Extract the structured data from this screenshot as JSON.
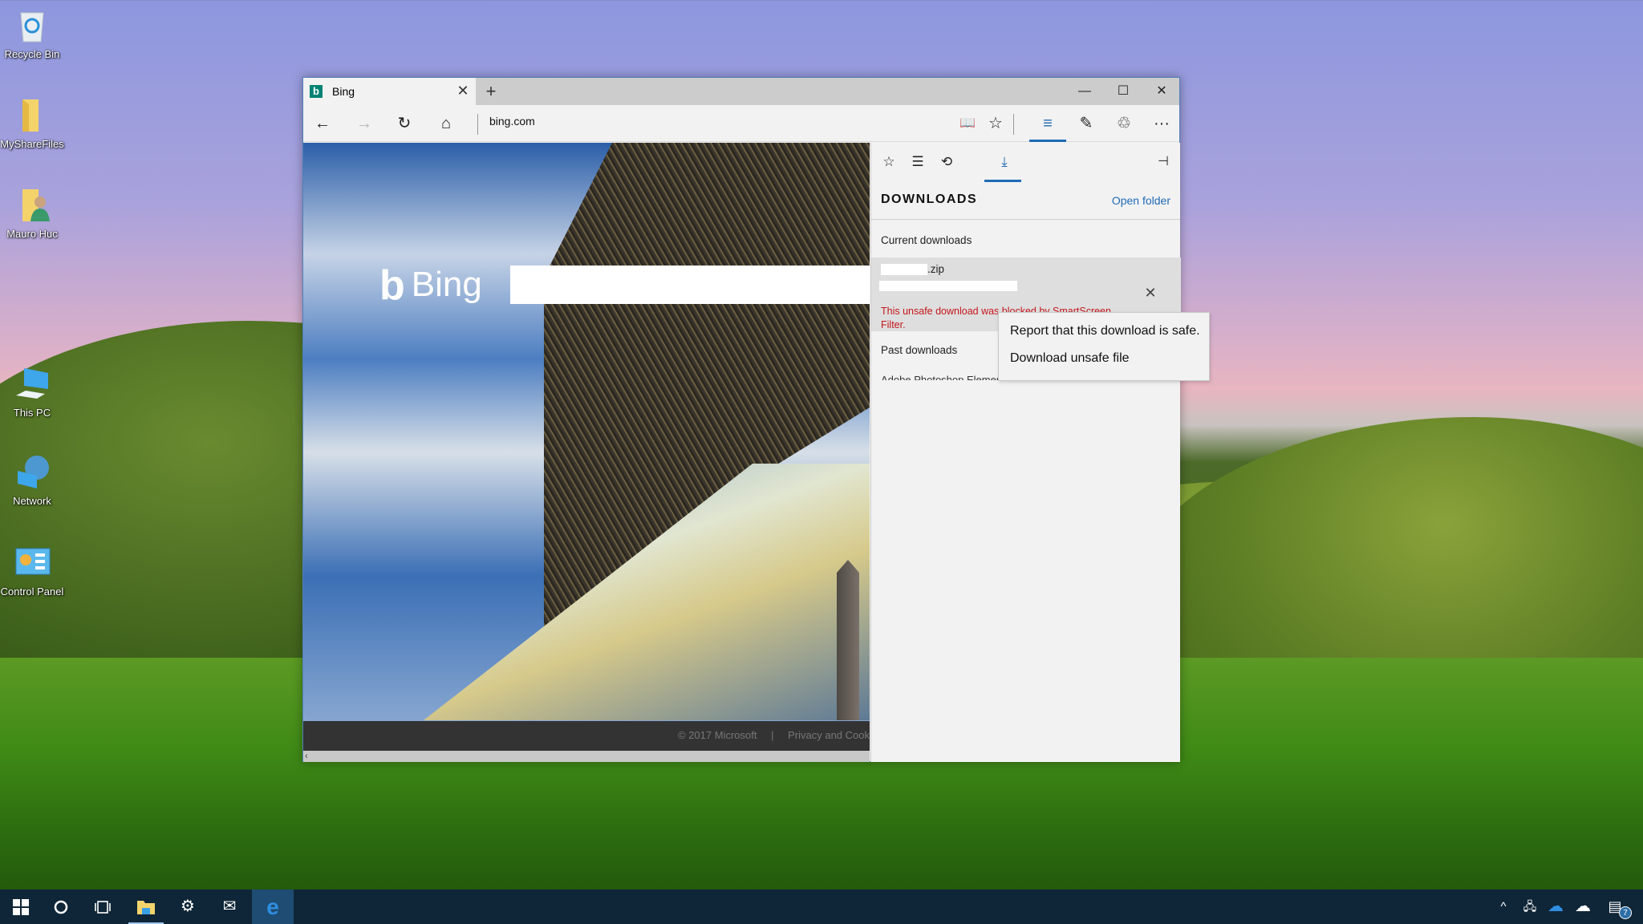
{
  "desktop": {
    "icons": [
      {
        "label": "Recycle Bin",
        "icon": "recycle-bin-icon"
      },
      {
        "label": "MyShareFiles",
        "icon": "folder-icon"
      },
      {
        "label": "Mauro Huc",
        "icon": "user-folder-icon"
      },
      {
        "label": "This PC",
        "icon": "computer-icon"
      },
      {
        "label": "Network",
        "icon": "network-icon"
      },
      {
        "label": "Control Panel",
        "icon": "control-panel-icon"
      }
    ]
  },
  "browser": {
    "tab": {
      "title": "Bing",
      "favicon": "b",
      "close": "✕"
    },
    "new_tab": "+",
    "window_controls": {
      "minimize": "—",
      "maximize": "☐",
      "close": "✕"
    },
    "toolbar": {
      "back": "←",
      "forward": "→",
      "refresh": "↻",
      "home": "⌂",
      "address": "bing.com",
      "reading_view": "📖",
      "favorite": "☆",
      "hub": "≡",
      "web_note": "✎",
      "share": "♲",
      "more": "···"
    },
    "page": {
      "logo_mark": "b",
      "logo_text": "Bing",
      "search_placeholder": "",
      "footer_copyright": "© 2017 Microsoft",
      "footer_sep": "|",
      "footer_link": "Privacy and Cook",
      "scroll_left": "‹"
    },
    "hub": {
      "tabs": [
        {
          "name": "favorites",
          "glyph": "☆"
        },
        {
          "name": "reading-list",
          "glyph": "☰"
        },
        {
          "name": "history",
          "glyph": "⟲"
        },
        {
          "name": "downloads",
          "glyph": "⤓",
          "active": true
        }
      ],
      "pin": "⊣",
      "title": "DOWNLOADS",
      "open_folder": "Open folder",
      "current_label": "Current downloads",
      "current_item": {
        "file_name": ".zip",
        "close": "✕",
        "warning": "This unsafe download was blocked by SmartScreen Filter."
      },
      "past_label": "Past downloads",
      "past_items": [
        "Adobe Photoshop Elements ... ... ..."
      ]
    },
    "context_menu": {
      "items": [
        "Report that this download is safe.",
        "Download unsafe file"
      ]
    }
  },
  "taskbar": {
    "start": "⊞",
    "cortana": "○",
    "task_view": "❐",
    "apps": [
      {
        "name": "file-explorer",
        "glyph": "📁",
        "running": true
      },
      {
        "name": "settings",
        "glyph": "⚙"
      },
      {
        "name": "mail",
        "glyph": "✉"
      },
      {
        "name": "edge",
        "glyph": "e",
        "active": true
      }
    ],
    "tray": {
      "chevron": "^",
      "network": "🖧",
      "onedrive_blue": "☁",
      "onedrive_white": "☁",
      "action_center": "▤",
      "notification_count": "7"
    }
  },
  "colors": {
    "accent": "#1f6bb5",
    "warning": "#c4161c",
    "bing_favicon": "#008373",
    "taskbar": "#0f2638"
  }
}
